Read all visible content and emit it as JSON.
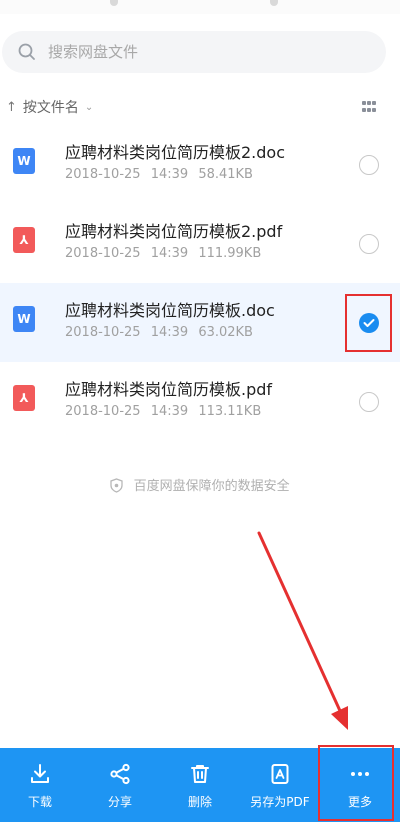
{
  "search": {
    "placeholder": "搜索网盘文件",
    "icon": "search-icon"
  },
  "sort": {
    "arrow": "↑",
    "label": "按文件名",
    "icon": "sort-arrow-icon"
  },
  "files": [
    {
      "name": "应聘材料类岗位简历模板2.doc",
      "date": "2018-10-25",
      "time": "14:39",
      "size": "58.41KB",
      "type": "doc",
      "badge": "W",
      "selected": false
    },
    {
      "name": "应聘材料类岗位简历模板2.pdf",
      "date": "2018-10-25",
      "time": "14:39",
      "size": "111.99KB",
      "type": "pdf",
      "badge": "⅄",
      "selected": false
    },
    {
      "name": "应聘材料类岗位简历模板.doc",
      "date": "2018-10-25",
      "time": "14:39",
      "size": "63.02KB",
      "type": "doc",
      "badge": "W",
      "selected": true
    },
    {
      "name": "应聘材料类岗位简历模板.pdf",
      "date": "2018-10-25",
      "time": "14:39",
      "size": "113.11KB",
      "type": "pdf",
      "badge": "⅄",
      "selected": false
    }
  ],
  "safety_notice": "百度网盘保障你的数据安全",
  "toolbar": {
    "download": "下载",
    "share": "分享",
    "delete": "删除",
    "save_pdf": "另存为PDF",
    "more": "更多"
  },
  "colors": {
    "accent": "#1e95f3",
    "annotation": "#e53030",
    "doc": "#3e86f5",
    "pdf": "#f25a5a",
    "selected_row": "#f0f6ff"
  }
}
